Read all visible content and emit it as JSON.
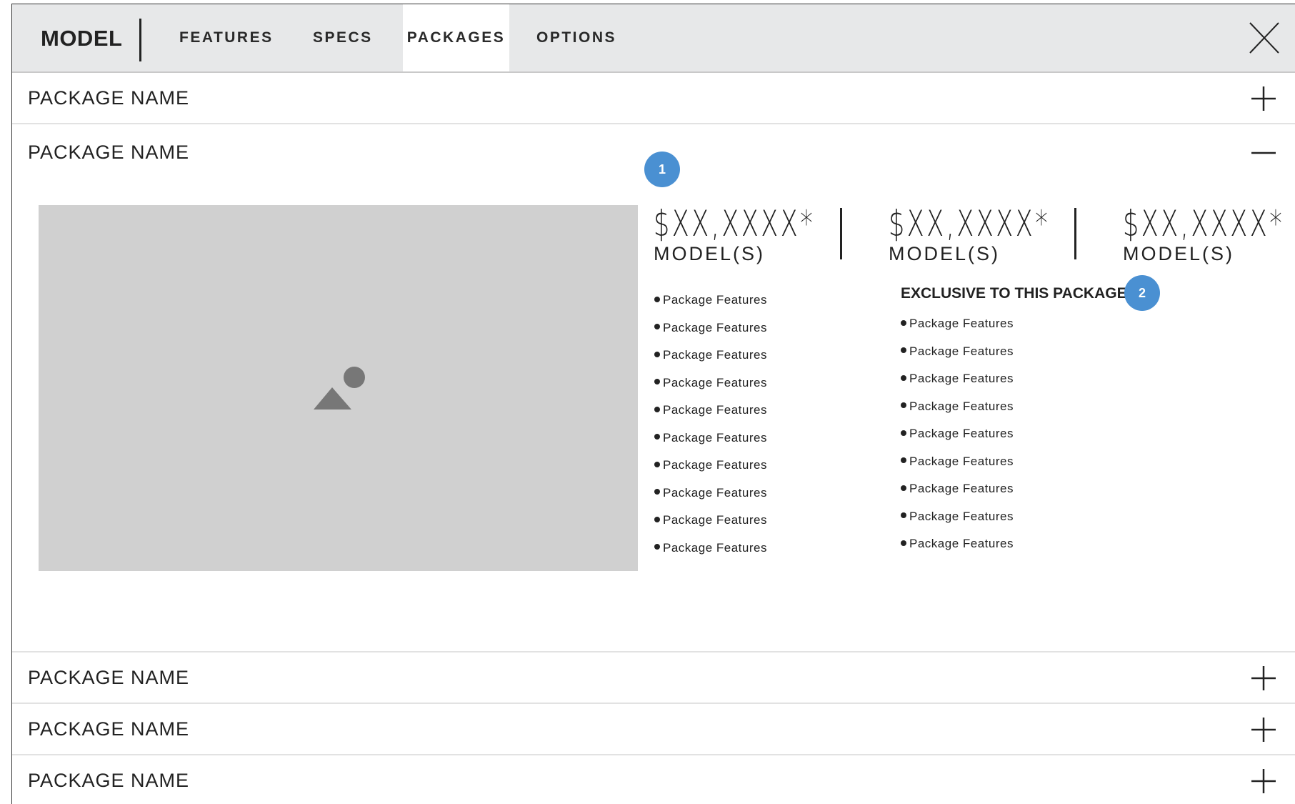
{
  "nav": {
    "brand": "MODEL",
    "tabs": [
      {
        "label": "FEATURES"
      },
      {
        "label": "SPECS"
      },
      {
        "label": "PACKAGES"
      },
      {
        "label": "OPTIONS"
      }
    ],
    "active_tab": "PACKAGES",
    "close_icon": "close-x-icon"
  },
  "packages": [
    {
      "name": "PACKAGE NAME",
      "expanded": false,
      "icon": "plus-icon"
    },
    {
      "name": "PACKAGE NAME",
      "expanded": true,
      "icon": "minus-icon"
    },
    {
      "name": "PACKAGE NAME",
      "expanded": false,
      "icon": "plus-icon"
    },
    {
      "name": "PACKAGE NAME",
      "expanded": false,
      "icon": "plus-icon"
    },
    {
      "name": "PACKAGE NAME",
      "expanded": false,
      "icon": "plus-icon"
    }
  ],
  "detail": {
    "image_icon": "image-placeholder-icon",
    "badges": [
      "1",
      "2"
    ],
    "prices": [
      {
        "price": "$XX,XXXX*",
        "label": "MODEL(S)"
      },
      {
        "price": "$XX,XXXX*",
        "label": "MODEL(S)"
      },
      {
        "price": "$XX,XXXX*",
        "label": "MODEL(S)"
      }
    ],
    "features": [
      "Package Features",
      "Package Features",
      "Package Features",
      "Package Features",
      "Package Features",
      "Package Features",
      "Package Features",
      "Package Features",
      "Package Features",
      "Package Features"
    ],
    "exclusive_title": "EXCLUSIVE TO THIS PACKAGE",
    "exclusive_features": [
      "Package Features",
      "Package Features",
      "Package Features",
      "Package Features",
      "Package Features",
      "Package Features",
      "Package Features",
      "Package Features",
      "Package Features"
    ]
  },
  "colors": {
    "nav_bg": "#e7e8e9",
    "badge": "#4a90d2",
    "image_placeholder": "#d0d0d0"
  }
}
